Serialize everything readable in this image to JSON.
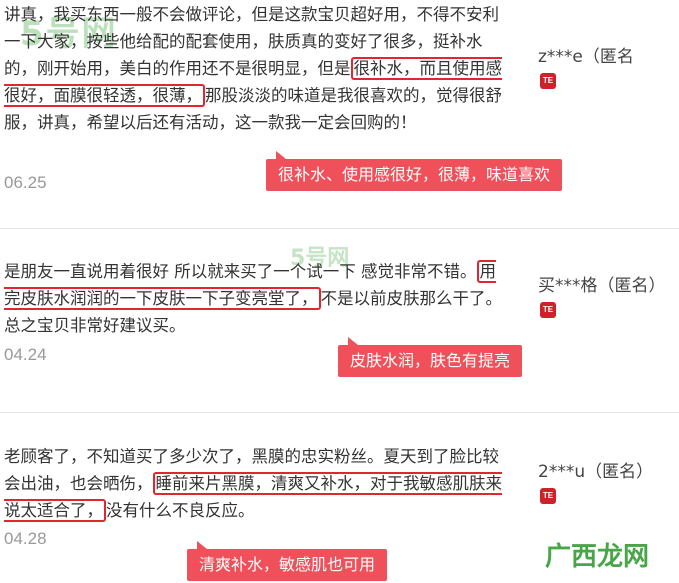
{
  "reviews": [
    {
      "text_pre": "讲真，我买东西一般不会做评论，但是这款宝贝超好用，不得不安利一下大家，按些他给配的配套使用，肤质真的变好了很多，挺补水的，刚开始用，美白的作用还不是很明显，但是",
      "highlight": "很补水，而且使用感很好，面膜很轻透，很薄，",
      "text_post": "那股淡淡的味道是我很喜欢的，觉得很舒服，讲真，希望以后还有活动，这一款我一定会回购的！",
      "date": "06.25",
      "user": "z***e（匿名",
      "badge": "TE",
      "callout": "很补水、使用感很好，很薄，味道喜欢"
    },
    {
      "text_pre": "是朋友一直说用着很好 所以就来买了一个试一下 感觉非常不错。",
      "highlight": "用完皮肤水润润的一下皮肤一下子变亮堂了，",
      "text_post": "不是以前皮肤那么干了。总之宝贝非常好建议买。",
      "date": "04.24",
      "user": "买***格（匿名）",
      "badge": "TE",
      "callout": "皮肤水润，肤色有提亮"
    },
    {
      "text_pre": "老顾客了，不知道买了多少次了，黑膜的忠实粉丝。夏天到了脸比较会出油，也会晒伤，",
      "highlight": "睡前来片黑膜，清爽又补水，对于我敏感肌肤来说太适合了，",
      "text_post": "没有什么不良反应。",
      "date": "04.28",
      "user": "2***u（匿名）",
      "badge": "TE",
      "callout": "清爽补水，敏感肌也可用"
    }
  ],
  "watermarks": {
    "top_left": "5号网",
    "middle": "5号网",
    "bottom_right": "广西龙网"
  }
}
